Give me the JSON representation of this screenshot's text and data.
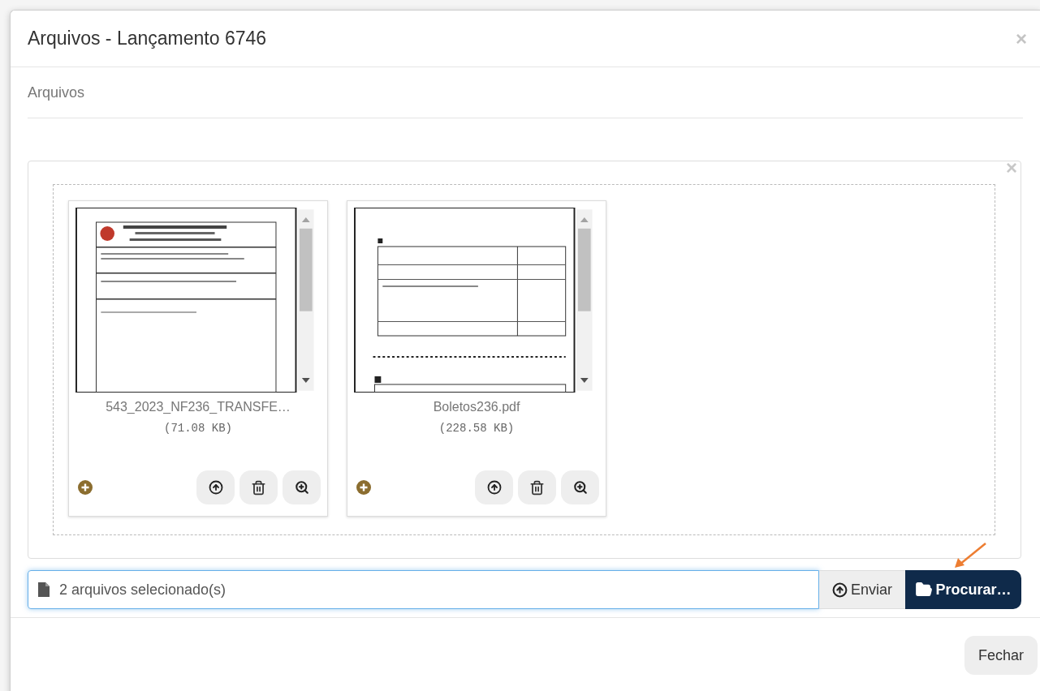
{
  "dialog": {
    "title": "Arquivos - Lançamento 6746",
    "close": "×",
    "section_label": "Arquivos",
    "panel_close": "×",
    "files": [
      {
        "name": "543_2023_NF236_TRANSFE…",
        "size": "(71.08 KB)"
      },
      {
        "name": "Boletos236.pdf",
        "size": "(228.58 KB)"
      }
    ],
    "selection_text": "2 arquivos selecionado(s)",
    "upload_button": "Enviar",
    "browse_button": "Procurar…",
    "close_button": "Fechar"
  }
}
